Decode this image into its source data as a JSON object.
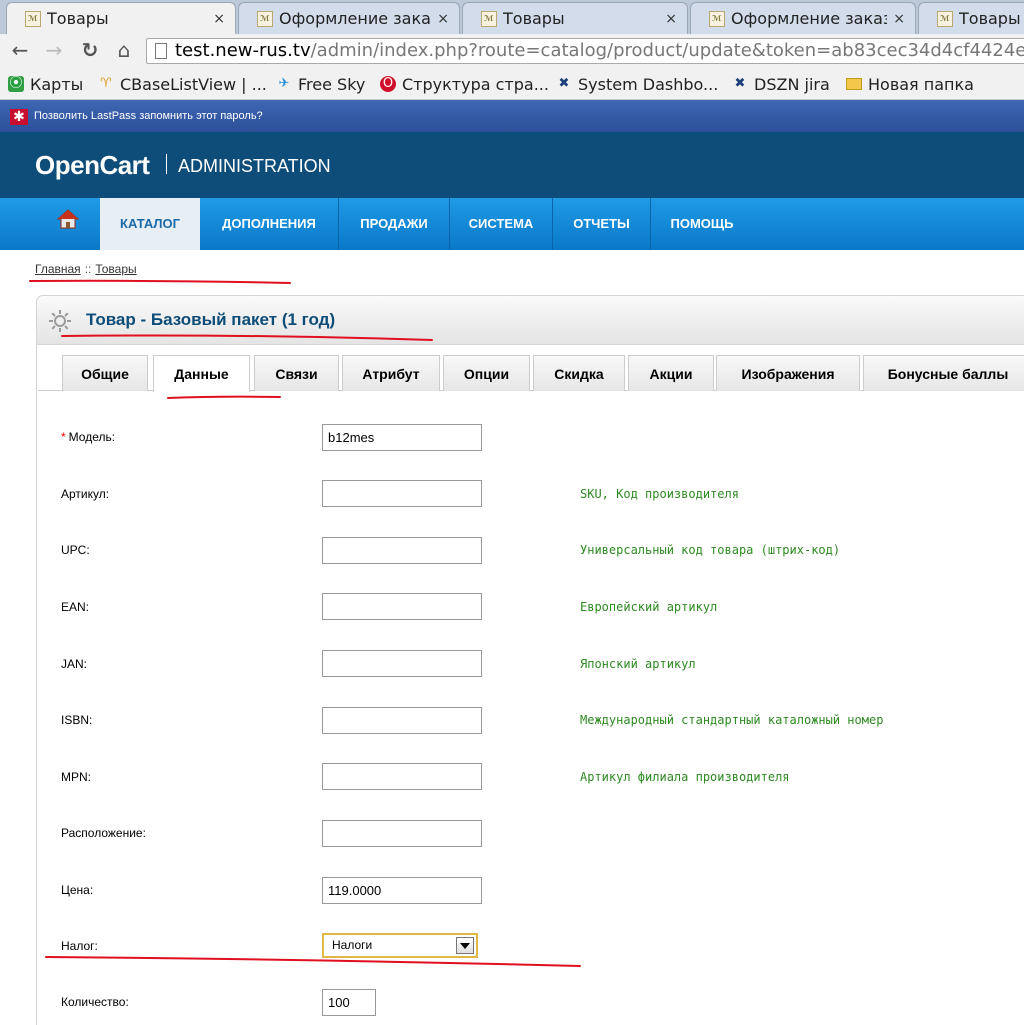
{
  "browser": {
    "tabs": [
      {
        "title": "Товары",
        "active": true
      },
      {
        "title": "Оформление заказа",
        "active": false
      },
      {
        "title": "Товары",
        "active": false
      },
      {
        "title": "Оформление заказа",
        "active": false
      },
      {
        "title": "Товары",
        "active": false
      }
    ],
    "favicon_glyph": "ℳ",
    "close_glyph": "×",
    "url_host": "test.new-rus.tv",
    "url_path": "/admin/index.php?route=catalog/product/update&token=ab83cec34d4cf4424e",
    "bookmarks": [
      {
        "label": "Карты",
        "icon": "maps-icon"
      },
      {
        "label": "CBaseListView | ...",
        "icon": "bird-icon"
      },
      {
        "label": "Free Sky",
        "icon": "plane-icon"
      },
      {
        "label": "Структура стра...",
        "icon": "opera-icon"
      },
      {
        "label": "System Dashbo...",
        "icon": "jira-icon"
      },
      {
        "label": "DSZN jira",
        "icon": "jira-icon"
      },
      {
        "label": "Новая папка",
        "icon": "folder-icon"
      }
    ],
    "lastpass_prompt": "Позволить LastPass запомнить этот пароль?"
  },
  "header": {
    "logo": "OpenCart",
    "subtitle": "ADMINISTRATION"
  },
  "menu": {
    "items": [
      "КАТАЛОГ",
      "ДОПОЛНЕНИЯ",
      "ПРОДАЖИ",
      "СИСТЕМА",
      "ОТЧЕТЫ",
      "ПОМОЩЬ"
    ],
    "active": "КАТАЛОГ"
  },
  "breadcrumb": {
    "home": "Главная",
    "separator": "::",
    "current": "Товары"
  },
  "page": {
    "title": "Товар - Базовый пакет (1 год)"
  },
  "product_tabs": {
    "items": [
      "Общие",
      "Данные",
      "Связи",
      "Атрибут",
      "Опции",
      "Скидка",
      "Акции",
      "Изображения",
      "Бонусные баллы"
    ],
    "active": "Данные"
  },
  "form": {
    "required_mark": "*",
    "model": {
      "label": "Модель:",
      "value": "b12mes"
    },
    "sku": {
      "label": "Артикул:",
      "value": "",
      "hint": "SKU, Код производителя"
    },
    "upc": {
      "label": "UPC:",
      "value": "",
      "hint": "Универсальный код товара (штрих-код)"
    },
    "ean": {
      "label": "EAN:",
      "value": "",
      "hint": "Европейский артикул"
    },
    "jan": {
      "label": "JAN:",
      "value": "",
      "hint": "Японский артикул"
    },
    "isbn": {
      "label": "ISBN:",
      "value": "",
      "hint": "Международный стандартный каталожный номер"
    },
    "mpn": {
      "label": "MPN:",
      "value": "",
      "hint": "Артикул филиала производителя"
    },
    "location": {
      "label": "Расположение:",
      "value": ""
    },
    "price": {
      "label": "Цена:",
      "value": "119.0000"
    },
    "tax": {
      "label": "Налог:",
      "selected": "Налоги"
    },
    "quantity": {
      "label": "Количество:",
      "value": "100"
    }
  },
  "colors": {
    "header_bg": "#0e4d79",
    "menu_bg": "#1a8fdb",
    "hint_text": "#2e8b22",
    "annotation_red": "#e0101e"
  }
}
